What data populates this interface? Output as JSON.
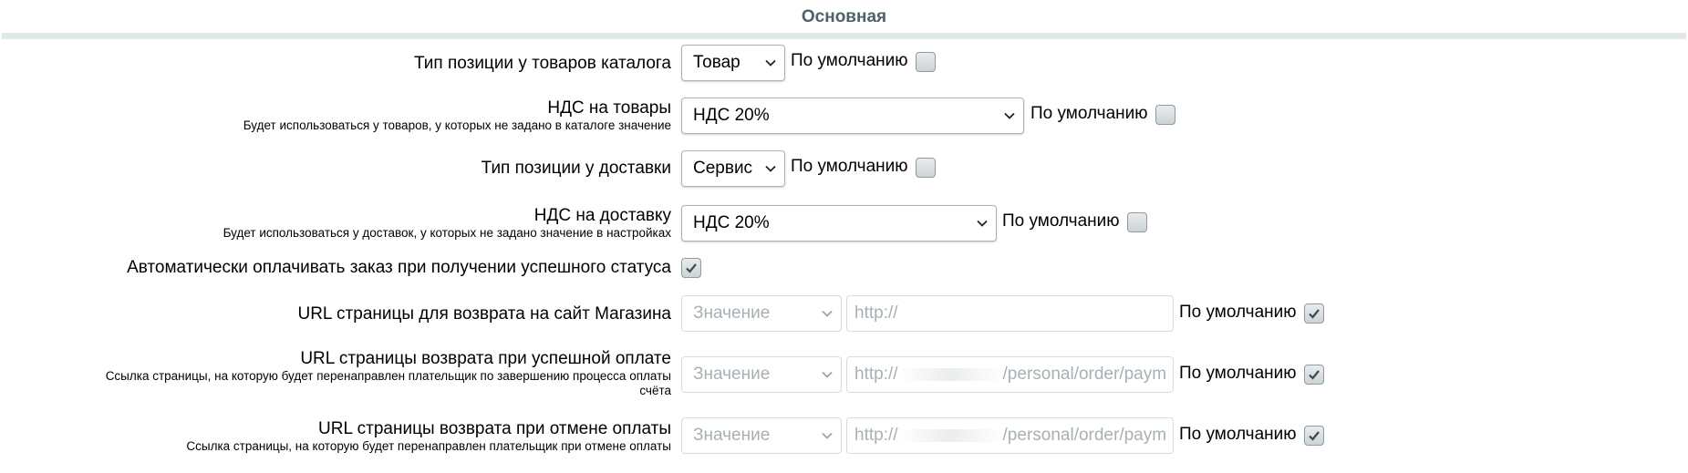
{
  "section": {
    "title": "Основная"
  },
  "default_label": "По умолчанию",
  "rows": {
    "item_type": {
      "label": "Тип позиции у товаров каталога",
      "value": "Товар",
      "default_checked": false
    },
    "vat_goods": {
      "label": "НДС на товары",
      "hint": "Будет использоваться у товаров, у которых не задано в каталоге значение",
      "value": "НДС 20%",
      "default_checked": false
    },
    "delivery_type": {
      "label": "Тип позиции у доставки",
      "value": "Сервис",
      "default_checked": false
    },
    "vat_delivery": {
      "label": "НДС на доставку",
      "hint": "Будет использоваться у доставок, у которых не задано значение в настройках",
      "value": "НДС 20%",
      "default_checked": false
    },
    "auto_pay": {
      "label": "Автоматически оплачивать заказ при получении успешного статуса",
      "checked": true
    },
    "return_url": {
      "label": "URL страницы для возврата на сайт Магазина",
      "select_value": "Значение",
      "input_placeholder": "http://",
      "default_checked": true
    },
    "success_url": {
      "label": "URL страницы возврата при успешной оплате",
      "hint_line1": "Ссылка страницы, на которую будет перенаправлен плательщик по завершению процесса оплаты",
      "hint_line2": "счёта",
      "select_value": "Значение",
      "input_prefix": "http://",
      "input_suffix": "/personal/order/paym",
      "default_checked": true
    },
    "cancel_url": {
      "label": "URL страницы возврата при отмене оплаты",
      "hint": "Ссылка страницы, на которую будет перенаправлен плательщик при отмене оплаты",
      "select_value": "Значение",
      "input_prefix": "http://",
      "input_suffix": "/personal/order/paym",
      "default_checked": true
    }
  },
  "icons": {
    "chevron": "chevron-down-icon",
    "check": "checkmark-icon"
  }
}
